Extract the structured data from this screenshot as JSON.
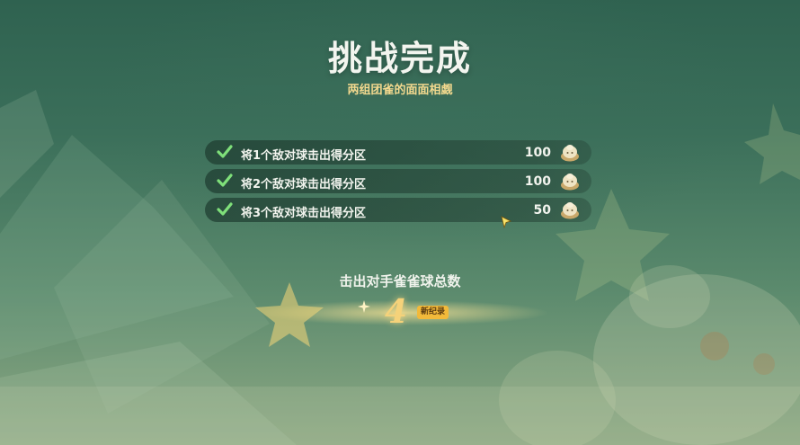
{
  "header": {
    "title": "挑战完成",
    "subtitle": "两组团雀的面面相觑"
  },
  "tasks": [
    {
      "label": "将1个敌对球击出得分区",
      "value": "100",
      "completed": true
    },
    {
      "label": "将2个敌对球击出得分区",
      "value": "100",
      "completed": true
    },
    {
      "label": "将3个敌对球击出得分区",
      "value": "50",
      "completed": true
    }
  ],
  "summary": {
    "label": "击出对手雀雀球总数",
    "value": "4",
    "badge": "新纪录"
  },
  "icons": {
    "check": "checkmark-icon",
    "reward": "coin-icon",
    "cursor": "cursor-icon"
  },
  "colors": {
    "check": "#7fe07a",
    "subtitle": "#f3d98e",
    "total_value": "#f5d27a",
    "badge_bg": "#f2b93a"
  }
}
